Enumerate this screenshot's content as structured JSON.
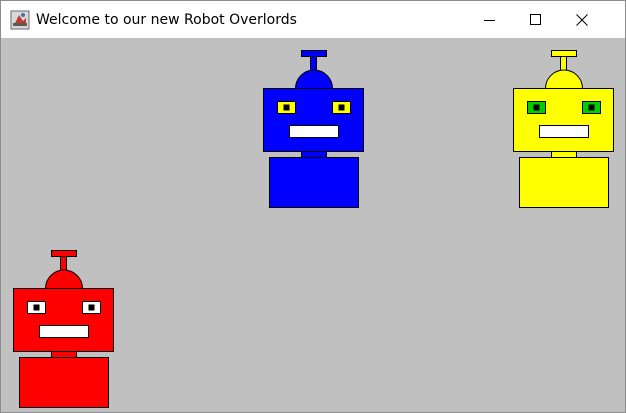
{
  "window": {
    "title": "Welcome to our new Robot Overlords",
    "controls": [
      "minimize-icon",
      "maximize-icon",
      "close-icon"
    ]
  },
  "canvas": {
    "background_color": "#c0c0c0"
  },
  "robots": [
    {
      "name": "blue-robot",
      "body_color": "#0000ff",
      "eye_outer_color": "#ffff00",
      "eye_pupil_color": "#000000",
      "mouth_color": "#ffffff"
    },
    {
      "name": "yellow-robot",
      "body_color": "#ffff00",
      "eye_outer_color": "#00cc00",
      "eye_pupil_color": "#000000",
      "mouth_color": "#ffffff"
    },
    {
      "name": "red-robot",
      "body_color": "#ff0000",
      "eye_outer_color": "#ffffff",
      "eye_pupil_color": "#000000",
      "mouth_color": "#ffffff"
    }
  ]
}
